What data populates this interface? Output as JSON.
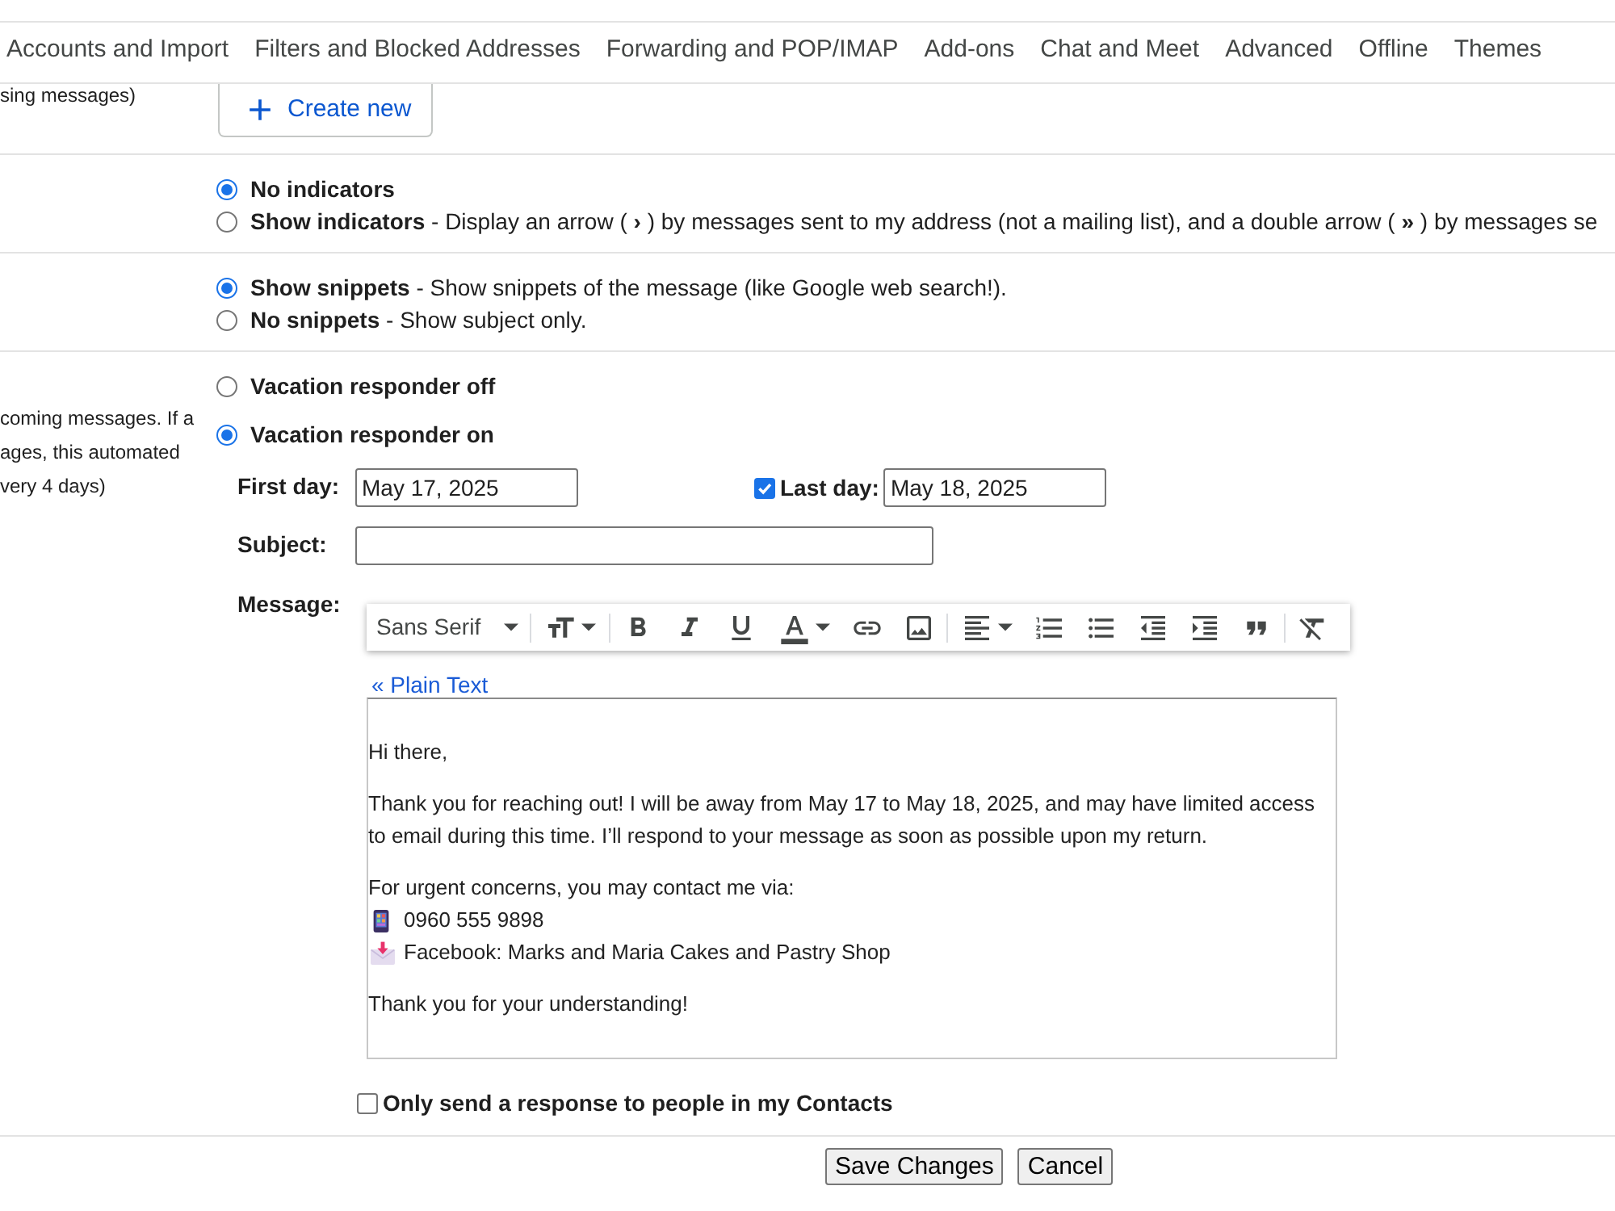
{
  "tabs": [
    {
      "label": "Accounts and Import",
      "selected": false
    },
    {
      "label": "Filters and Blocked Addresses",
      "selected": false
    },
    {
      "label": "Forwarding and POP/IMAP",
      "selected": false
    },
    {
      "label": "Add-ons",
      "selected": false
    },
    {
      "label": "Chat and Meet",
      "selected": false
    },
    {
      "label": "Advanced",
      "selected": false
    },
    {
      "label": "Offline",
      "selected": false
    },
    {
      "label": "Themes",
      "selected": false
    }
  ],
  "templates_section": {
    "note": "sing messages)",
    "create_button": "Create new"
  },
  "indicators_section": {
    "options": [
      {
        "label": "No indicators",
        "selected": true
      },
      {
        "label": "Show indicators",
        "description": "- Display an arrow ( **›** ) by messages sent to my address (not a mailing list), and a double arrow ( **»** ) by messages se",
        "selected": false
      }
    ]
  },
  "snippets_section": {
    "options": [
      {
        "label": "Show snippets",
        "description": "- Show snippets of the message (like Google web search!).",
        "selected": true
      },
      {
        "label": "No snippets",
        "description": "- Show subject only.",
        "selected": false
      }
    ]
  },
  "vacation_section": {
    "note_lines": [
      "coming messages. If a",
      "ages, this automated",
      "very 4 days)"
    ],
    "options": [
      {
        "label": "Vacation responder off",
        "selected": false
      },
      {
        "label": "Vacation responder on",
        "selected": true
      }
    ],
    "first_day": {
      "label": "First day:",
      "value": "May 17, 2025"
    },
    "last_day": {
      "label": "Last day:",
      "value": "May 18, 2025",
      "checked": true
    },
    "subject": {
      "label": "Subject:"
    },
    "message": {
      "label": "Message:",
      "font": "Sans Serif",
      "plain_text_link": "« Plain Text",
      "paragraphs": [
        {
          "lines": [
            {
              "kind": "text",
              "text": "Hi there,"
            }
          ]
        },
        {
          "lines": [
            {
              "kind": "text",
              "text": "Thank you for reaching out! I will be away from May 17 to May 18, 2025, and may have limited access to email during this time. I’ll respond to your message as soon as possible upon my return."
            }
          ]
        },
        {
          "lines": [
            {
              "kind": "text",
              "text": "For urgent concerns, you may contact me via:"
            },
            {
              "kind": "phone",
              "text": "0960 555 9898"
            },
            {
              "kind": "mail",
              "text": "Facebook: Marks and Maria Cakes and Pastry Shop"
            }
          ]
        },
        {
          "lines": [
            {
              "kind": "text",
              "text": "Thank you for your understanding!"
            }
          ]
        }
      ]
    },
    "contacts_only": {
      "label": "Only send a response to people in my Contacts",
      "checked": false
    }
  },
  "buttons": [
    "Save Changes",
    "Cancel"
  ]
}
